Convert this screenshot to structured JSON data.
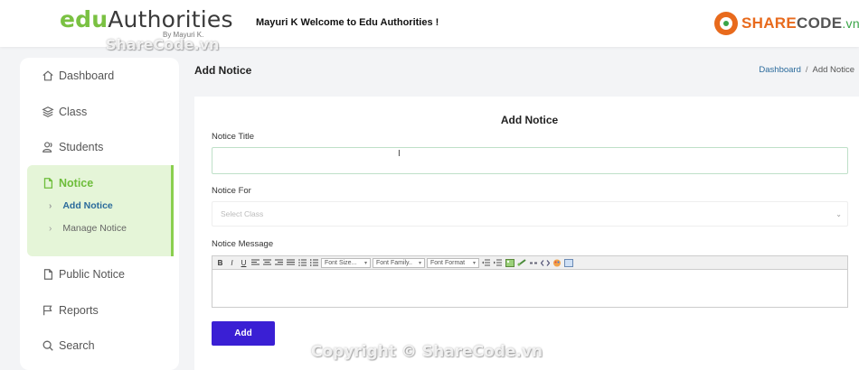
{
  "header": {
    "logo_edu": "edu",
    "logo_authorities": "Authorities",
    "logo_by": "By Mayuri K.",
    "welcome": "Mayuri K Welcome to Edu Authorities !",
    "brand_share": "SHARE",
    "brand_code": "CODE",
    "brand_vn": ".vn"
  },
  "watermarks": {
    "top": "ShareCode.vn",
    "bottom": "Copyright © ShareCode.vn"
  },
  "sidebar": {
    "items": [
      {
        "label": "Dashboard",
        "icon": "home-icon"
      },
      {
        "label": "Class",
        "icon": "layers-icon"
      },
      {
        "label": "Students",
        "icon": "users-icon"
      },
      {
        "label": "Notice",
        "icon": "file-icon"
      },
      {
        "label": "Public Notice",
        "icon": "file-icon"
      },
      {
        "label": "Reports",
        "icon": "flag-icon"
      },
      {
        "label": "Search",
        "icon": "search-icon"
      }
    ],
    "sub_items": [
      {
        "label": "Add Notice"
      },
      {
        "label": "Manage Notice"
      }
    ]
  },
  "page": {
    "title": "Add Notice",
    "breadcrumb": {
      "home": "Dashboard",
      "separator": "/",
      "current": "Add Notice"
    }
  },
  "form": {
    "card_title": "Add Notice",
    "notice_title_label": "Notice Title",
    "notice_title_value": "",
    "notice_for_label": "Notice For",
    "notice_for_placeholder": "Select Class",
    "notice_message_label": "Notice Message",
    "toolbar": {
      "bold": "B",
      "italic": "I",
      "underline": "U",
      "font_size": "Font Size...",
      "font_family": "Font Family..",
      "font_format": "Font Format"
    },
    "submit_label": "Add"
  },
  "colors": {
    "accent_green": "#6dbd3a",
    "active_bg": "#e5f5d8",
    "primary_button": "#3a1fd4",
    "link_blue": "#2a6a9b"
  }
}
